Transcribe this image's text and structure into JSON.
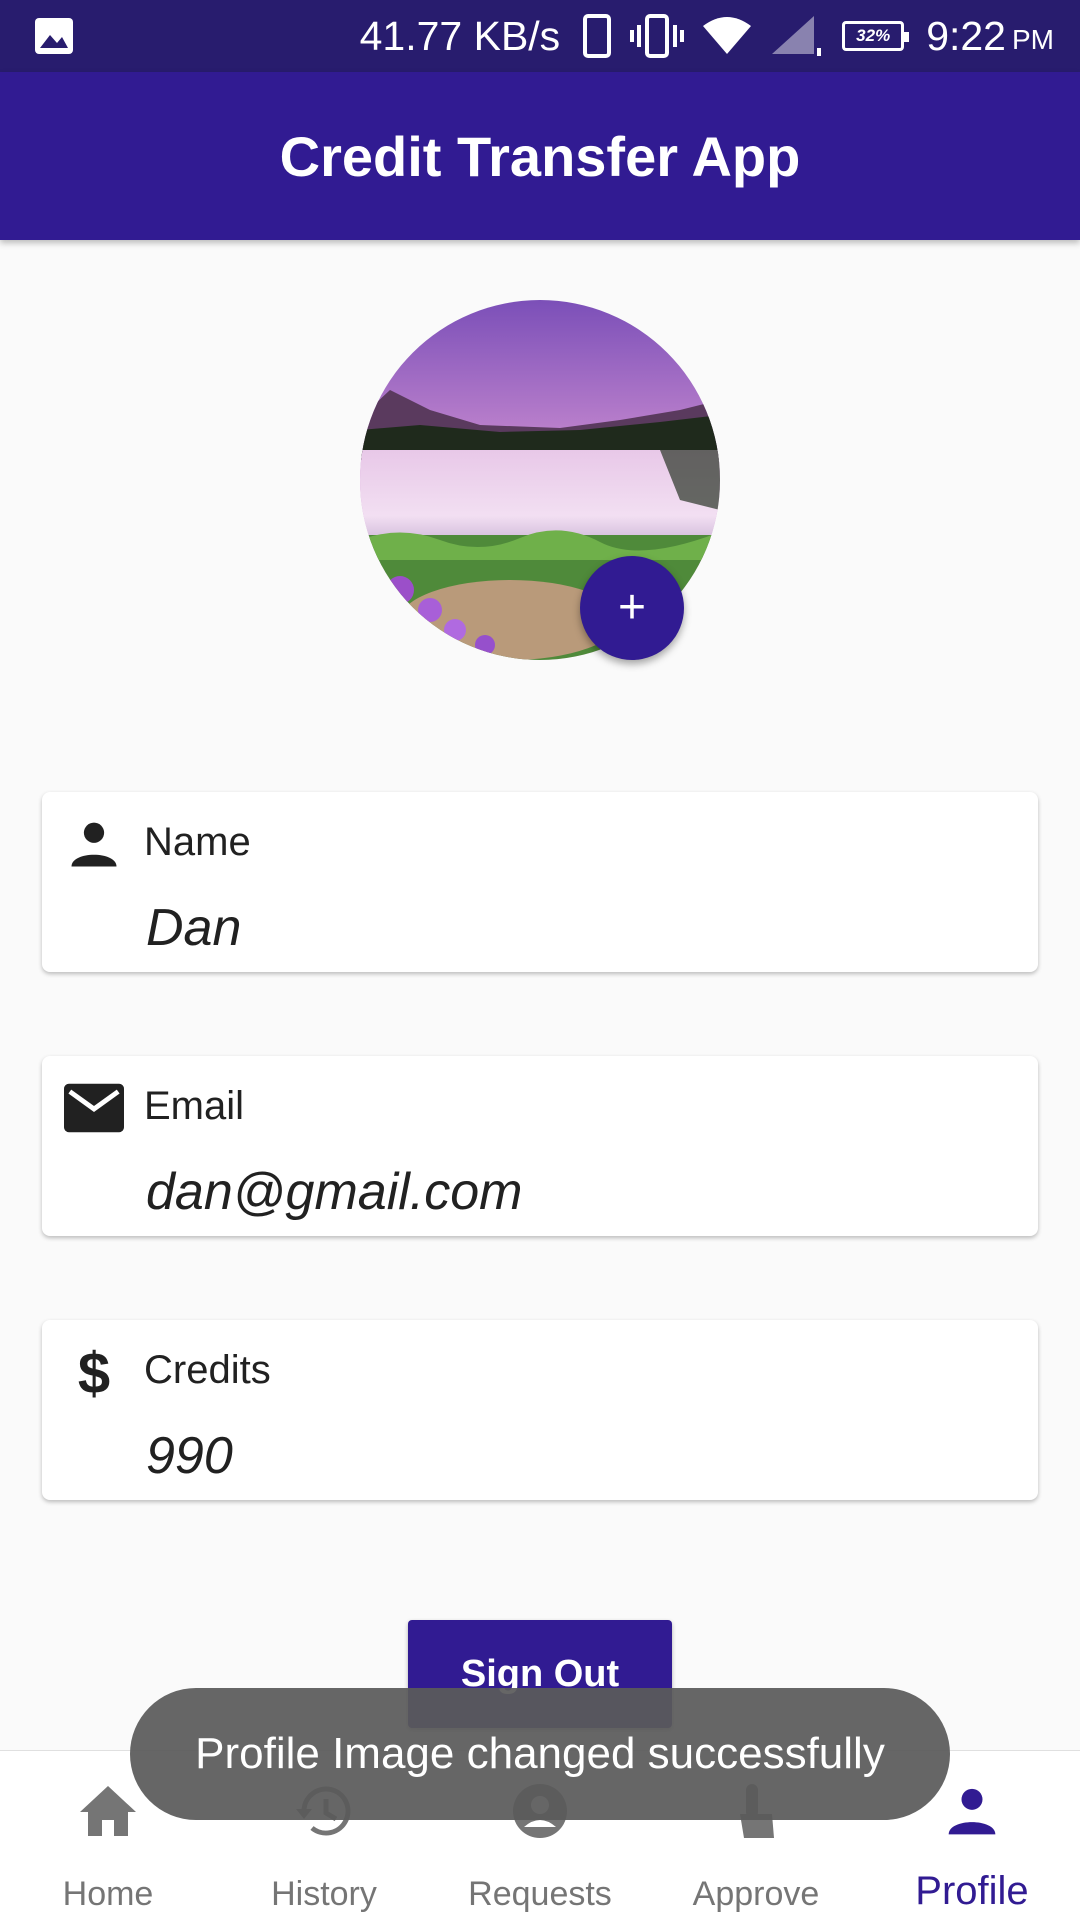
{
  "status_bar": {
    "network_speed": "41.77 KB/s",
    "battery_level": "32%",
    "time": "9:22",
    "ampm": "PM",
    "icons": [
      "gallery-icon",
      "phone-icon",
      "vibrate-icon",
      "wifi-icon",
      "signal-icon",
      "battery-icon"
    ]
  },
  "app_bar": {
    "title": "Credit Transfer App"
  },
  "profile": {
    "add_button_label": "+",
    "fields": {
      "name": {
        "label": "Name",
        "value": "Dan",
        "icon": "person-icon"
      },
      "email": {
        "label": "Email",
        "value": "dan@gmail.com",
        "icon": "mail-icon"
      },
      "credits": {
        "label": "Credits",
        "value": "990",
        "icon": "dollar-icon"
      }
    },
    "sign_out_label": "Sign Out"
  },
  "toast": {
    "message": "Profile Image changed successfully"
  },
  "bottom_nav": {
    "active": "Profile",
    "items": [
      {
        "label": "Home",
        "icon": "home-icon"
      },
      {
        "label": "History",
        "icon": "history-icon"
      },
      {
        "label": "Requests",
        "icon": "account-circle-icon"
      },
      {
        "label": "Approve",
        "icon": "touch-icon"
      },
      {
        "label": "Profile",
        "icon": "person-icon"
      }
    ]
  },
  "colors": {
    "primary": "#311b92",
    "status_bar": "#281c6e",
    "background": "#fafafa",
    "toast": "#5a5a5a",
    "inactive_nav": "#757575"
  }
}
